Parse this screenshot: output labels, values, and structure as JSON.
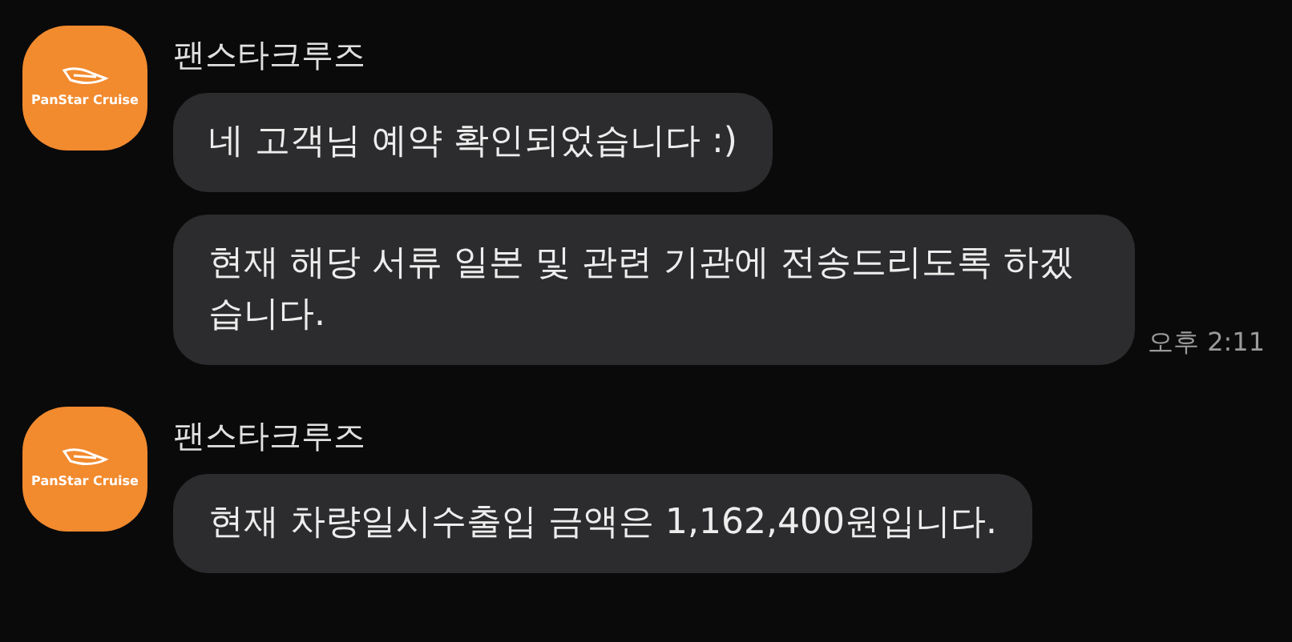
{
  "groups": [
    {
      "sender": "팬스타크루즈",
      "avatar_logo": "PanStar Cruise",
      "messages": [
        {
          "text": "네 고객님 예약 확인되었습니다 :)"
        },
        {
          "text": "현재 해당 서류 일본 및 관련 기관에 전송드리도록 하겠습니다."
        }
      ],
      "time": "오후 2:11"
    },
    {
      "sender": "팬스타크루즈",
      "avatar_logo": "PanStar Cruise",
      "messages": [
        {
          "text": "현재 차량일시수출입 금액은 1,162,400원입니다."
        }
      ]
    }
  ]
}
